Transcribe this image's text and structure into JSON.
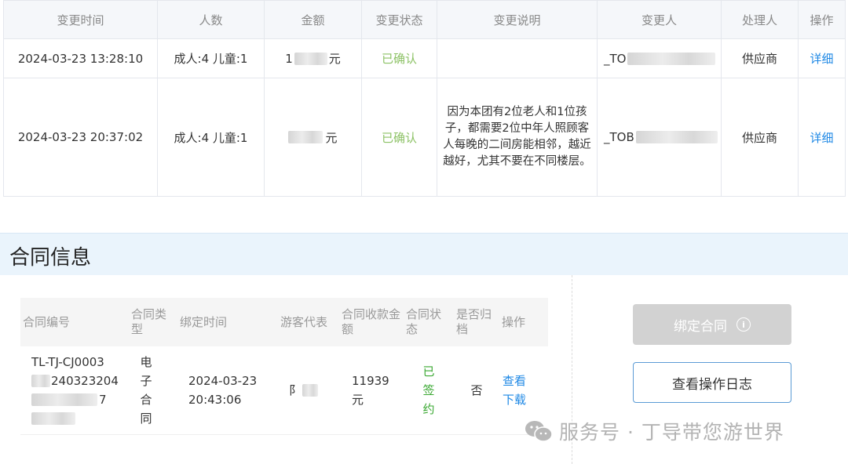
{
  "change_table": {
    "headers": [
      "变更时间",
      "人数",
      "金额",
      "变更状态",
      "变更说明",
      "变更人",
      "处理人",
      "操作"
    ],
    "rows": [
      {
        "time": "2024-03-23 13:28:10",
        "people": "成人:4 儿童:1",
        "amount_prefix": "1",
        "amount_unit": "元",
        "status": "已确认",
        "description": "",
        "changer_prefix": "_TO",
        "handler": "供应商",
        "action": "详细"
      },
      {
        "time": "2024-03-23 20:37:02",
        "people": "成人:4 儿童:1",
        "amount_prefix": "",
        "amount_unit": "元",
        "status": "已确认",
        "description": "因为本团有2位老人和1位孩子，都需要2位中年人照顾客人每晚的二间房能相邻，越近越好，尤其不要在不同楼层。",
        "changer_prefix": "_TOB",
        "handler": "供应商",
        "action": "详细"
      }
    ]
  },
  "contract_section": {
    "title": "合同信息",
    "headers": [
      "合同编号",
      "合同类型",
      "绑定时间",
      "游客代表",
      "合同收款金额",
      "合同状态",
      "是否归档",
      "操作"
    ],
    "row": {
      "contract_no_line1": "TL-TJ-CJ0003",
      "contract_no_line2": "240323204",
      "contract_no_line3": "7",
      "type": "电子合同",
      "bind_time_line1": "2024-03-23",
      "bind_time_line2": "20:43:06",
      "representative_prefix": "阝",
      "amount_line1": "11939",
      "amount_line2": "元",
      "status": "已签约",
      "archived": "否",
      "action_view": "查看",
      "action_download": "下载"
    },
    "buttons": {
      "bind": "绑定合同",
      "bind_info_icon": "i",
      "view_log": "查看操作日志"
    }
  },
  "watermark": {
    "text": "服务号 · 丁导带您游世界",
    "icon": "wechat-icon"
  },
  "colors": {
    "status_confirmed": "#8cc265",
    "status_signed": "#3aa832",
    "link": "#1e88e5",
    "section_bg": "#eaf4fc",
    "disabled_button": "#d2d2d2"
  }
}
